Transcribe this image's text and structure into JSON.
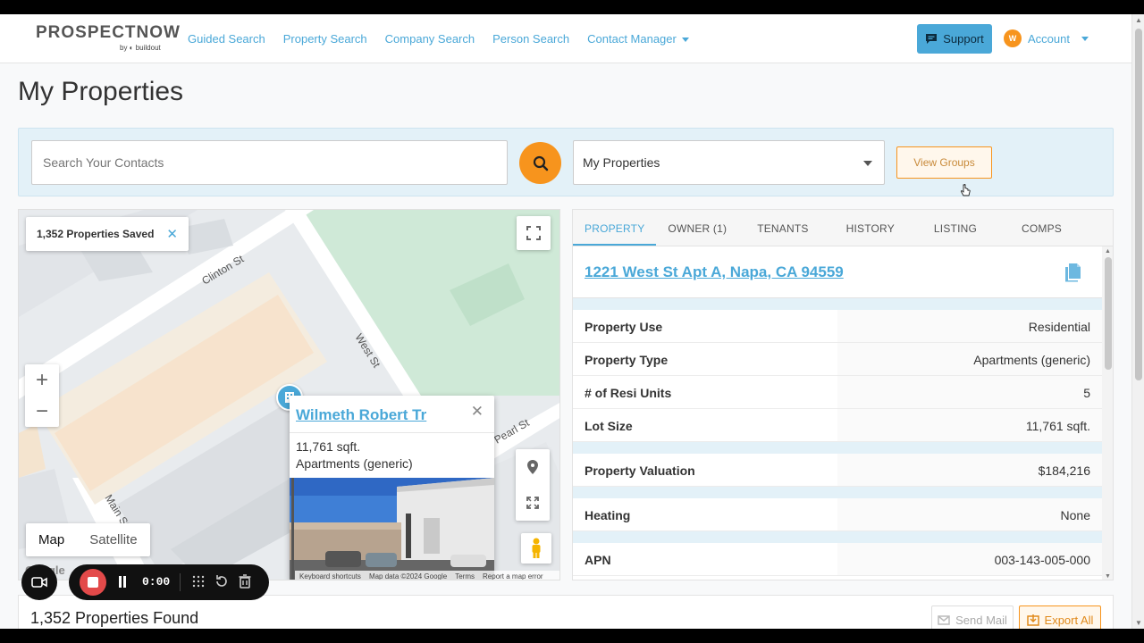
{
  "nav": {
    "logo_word_a": "PROSPECT",
    "logo_word_b": "NOW",
    "logo_by": "by ◐ buildout",
    "links": [
      "Guided Search",
      "Property Search",
      "Company Search",
      "Person Search",
      "Contact Manager"
    ],
    "support_label": "Support",
    "account_initial": "W",
    "account_label": "Account"
  },
  "page": {
    "title": "My Properties"
  },
  "search": {
    "placeholder": "Search Your Contacts",
    "select_value": "My Properties",
    "view_groups_label": "View Groups"
  },
  "map": {
    "saved_chip": "1,352 Properties Saved",
    "street_labels": [
      "Clinton St",
      "West St",
      "Pearl St",
      "Main St"
    ],
    "maptype": [
      "Map",
      "Satellite"
    ],
    "google": "Google",
    "footer": [
      "Keyboard shortcuts",
      "Map data ©2024 Google",
      "Terms",
      "Report a map error"
    ],
    "popup": {
      "name": "Wilmeth Robert Tr",
      "line1": "11,761 sqft.",
      "line2": "Apartments (generic)"
    }
  },
  "details": {
    "tabs": [
      "PROPERTY",
      "OWNER (1)",
      "TENANTS",
      "HISTORY",
      "LISTING",
      "COMPS"
    ],
    "active_tab": "PROPERTY",
    "address": "1221 West St Apt A, Napa, CA 94559",
    "rows": [
      {
        "label": "Property Use",
        "value": "Residential"
      },
      {
        "label": "Property Type",
        "value": "Apartments (generic)"
      },
      {
        "label": "# of Resi Units",
        "value": "5"
      },
      {
        "label": "Lot Size",
        "value": "11,761 sqft."
      },
      {
        "label": "Property Valuation",
        "value": "$184,216"
      },
      {
        "label": "Heating",
        "value": "None"
      },
      {
        "label": "APN",
        "value": "003-143-005-000"
      }
    ]
  },
  "bottom": {
    "found": "1,352 Properties Found",
    "send_mail": "Send Mail",
    "export_all": "Export All"
  },
  "recorder": {
    "time": "0:00"
  },
  "colors": {
    "accent": "#4aa8d8",
    "orange": "#f7941d",
    "band": "#e3f1f8"
  }
}
